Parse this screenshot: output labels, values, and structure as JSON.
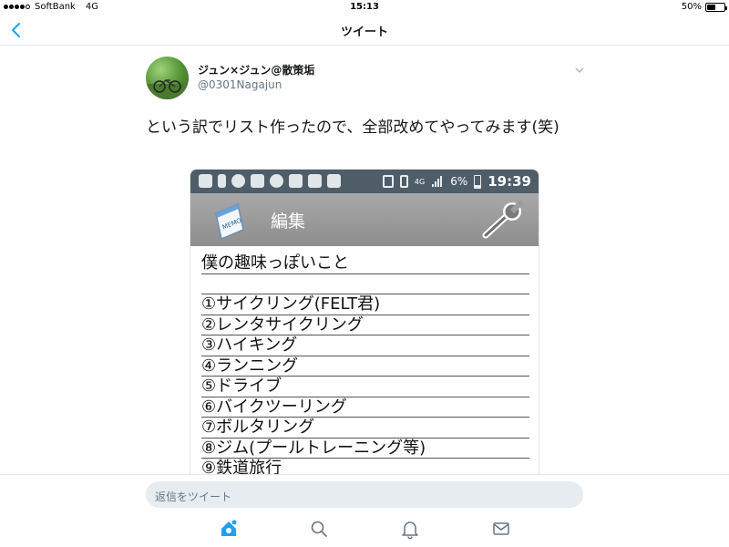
{
  "status_bar": {
    "carrier": "SoftBank",
    "network": "4G",
    "time": "15:13",
    "battery": "50%",
    "battery_level": 0.5
  },
  "nav": {
    "title": "ツイート",
    "back_icon": "chevron-left-icon"
  },
  "tweet": {
    "display_name": "ジュン×ジュン@散策垢",
    "handle": "@0301Nagajun",
    "text": "という訳でリスト作ったので、全部改めてやってみます(笑)"
  },
  "embedded_screenshot": {
    "android_status": {
      "network": "4G",
      "battery": "6%",
      "time": "19:39",
      "battery_level": 0.06
    },
    "app_title": "編集",
    "memo_heading": "僕の趣味っぽいこと",
    "memo_items": [
      "①サイクリング(FELT君)",
      "②レンタサイクリング",
      "③ハイキング",
      "④ランニング",
      "⑤ドライブ",
      "⑥バイクツーリング",
      "⑦ボルタリング",
      "⑧ジム(プールトレーニング等)",
      "⑨鉄道旅行"
    ]
  },
  "reply": {
    "placeholder": "返信をツイート"
  },
  "tabbar": {
    "items": [
      "home-icon",
      "search-icon",
      "notifications-icon",
      "messages-icon"
    ],
    "active": "home-icon"
  },
  "colors": {
    "accent": "#1da1f2",
    "text": "#14171a",
    "secondary_text": "#657786"
  }
}
